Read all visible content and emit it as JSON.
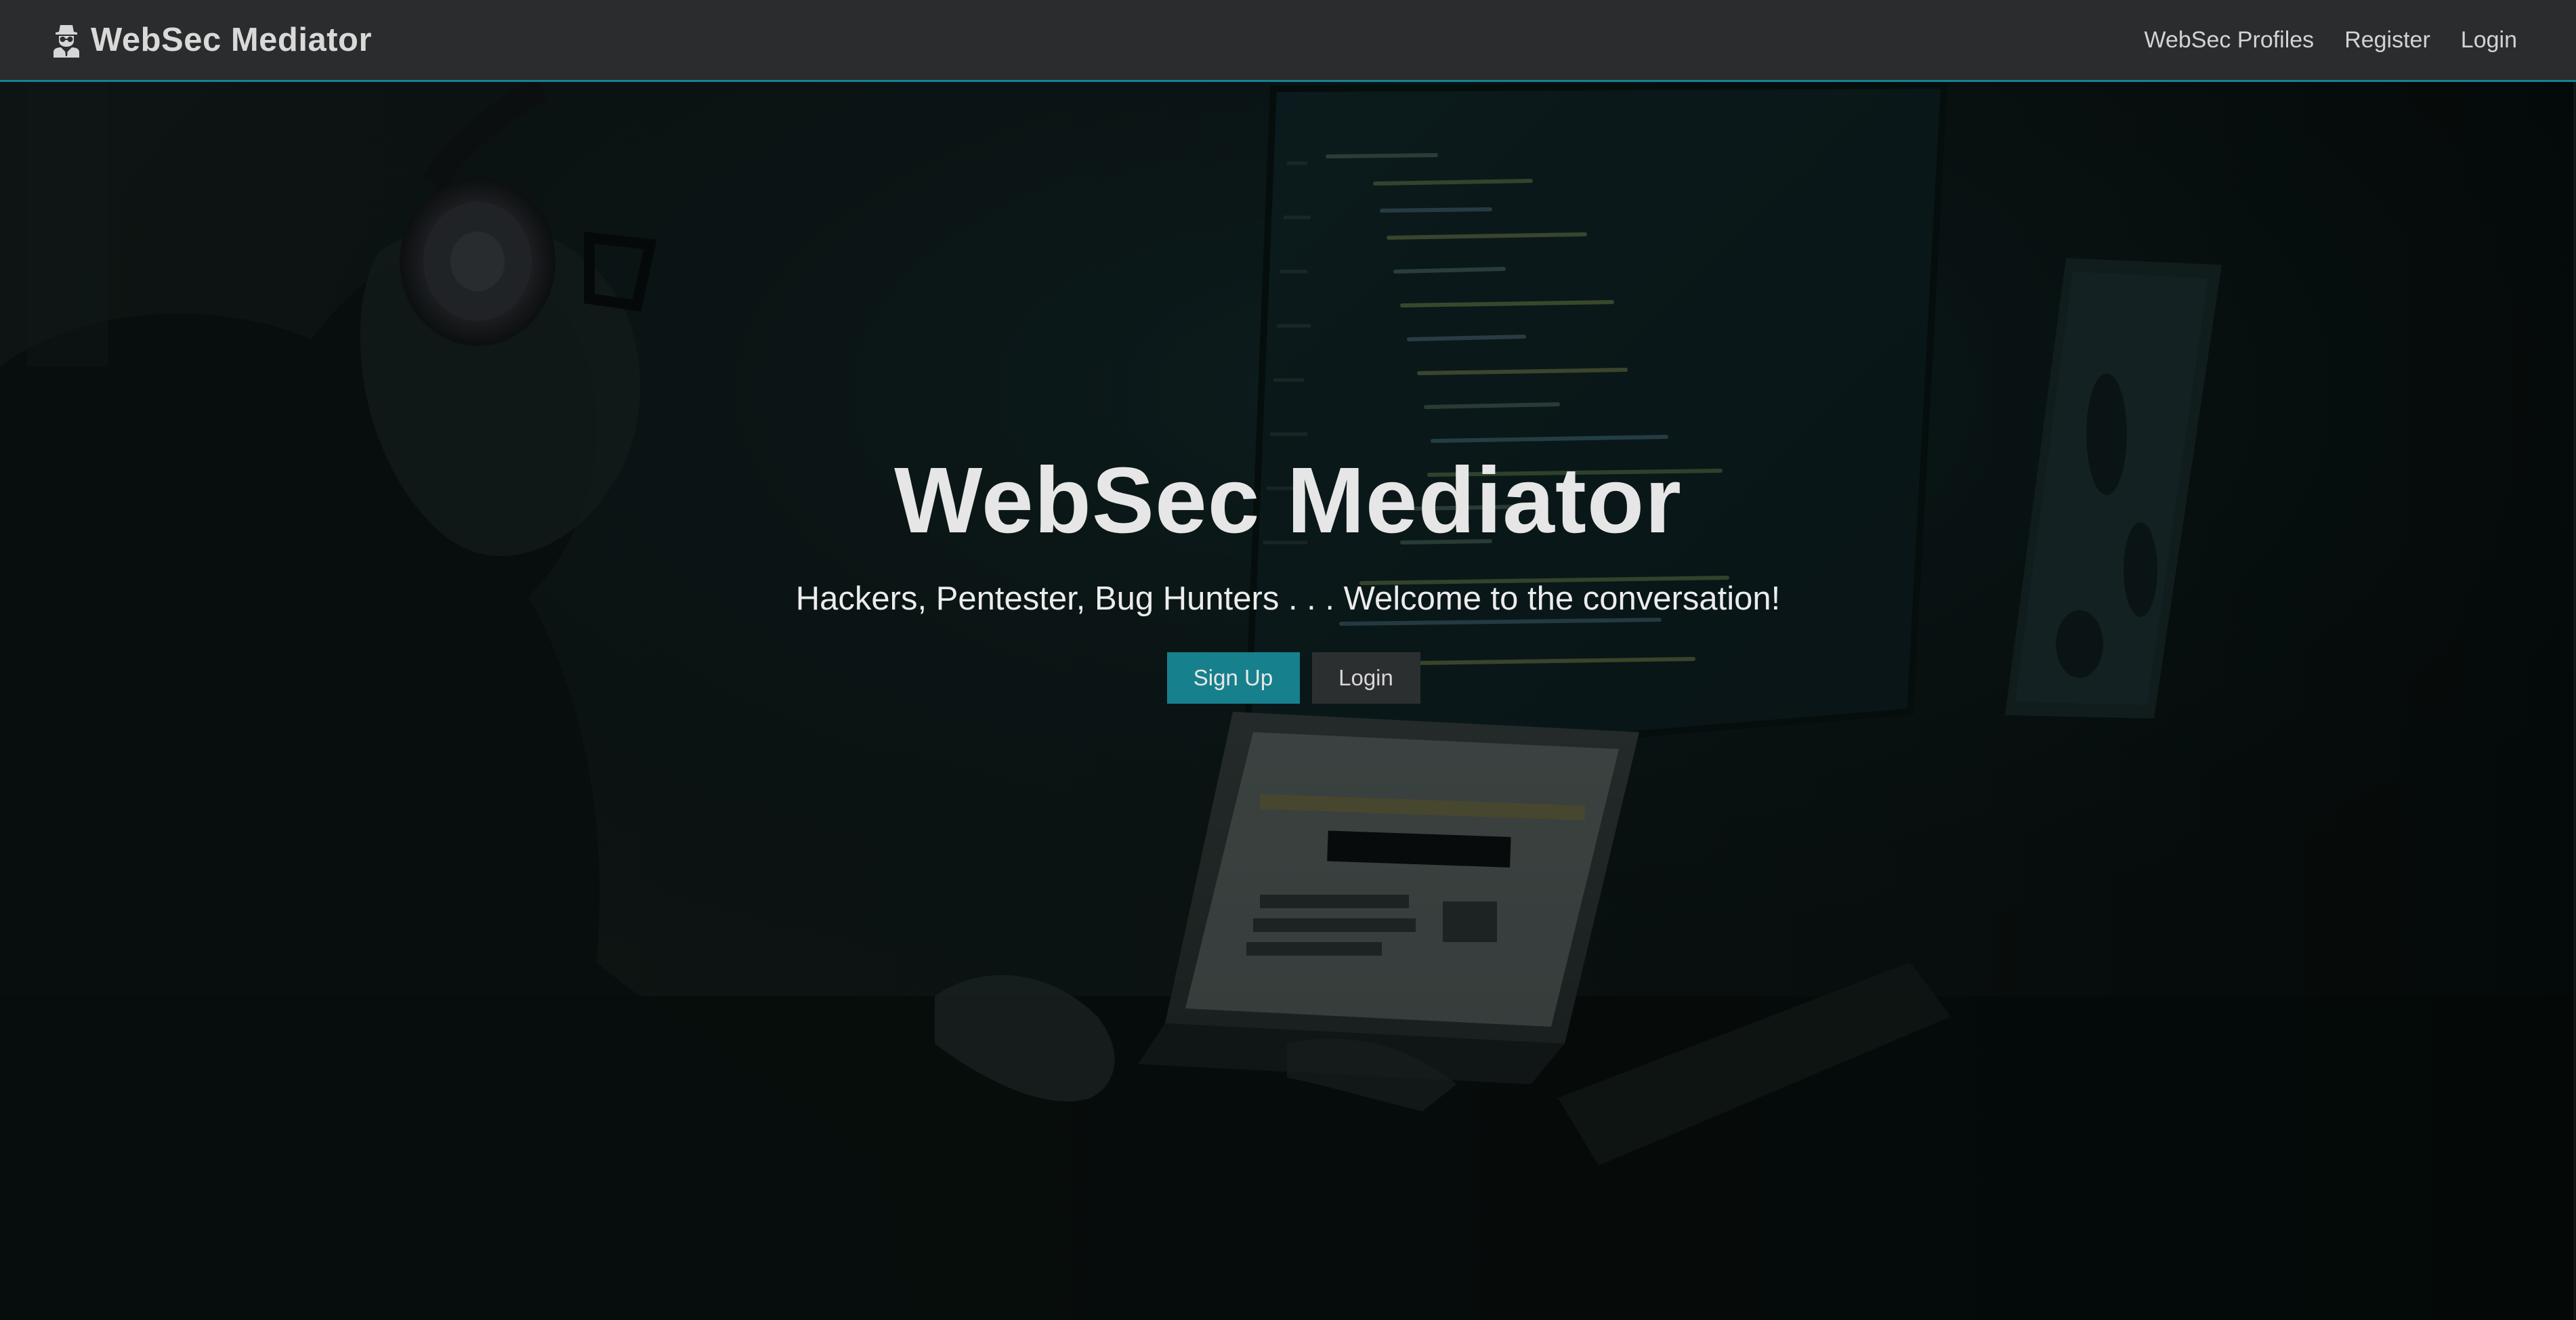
{
  "navbar": {
    "brand": "WebSec Mediator",
    "brand_icon": "user-secret-icon",
    "links": [
      "WebSec Profiles",
      "Register",
      "Login"
    ]
  },
  "hero": {
    "title": "WebSec Mediator",
    "subtitle": "Hackers, Pentester, Bug Hunters . . . Welcome to the conversation!",
    "signup_label": "Sign Up",
    "login_label": "Login"
  },
  "colors": {
    "navbar_bg": "#2a2c2e",
    "navbar_border": "#138496",
    "accent": "#17808d",
    "page_bg": "#0b1110",
    "text": "#e6e6e6"
  }
}
